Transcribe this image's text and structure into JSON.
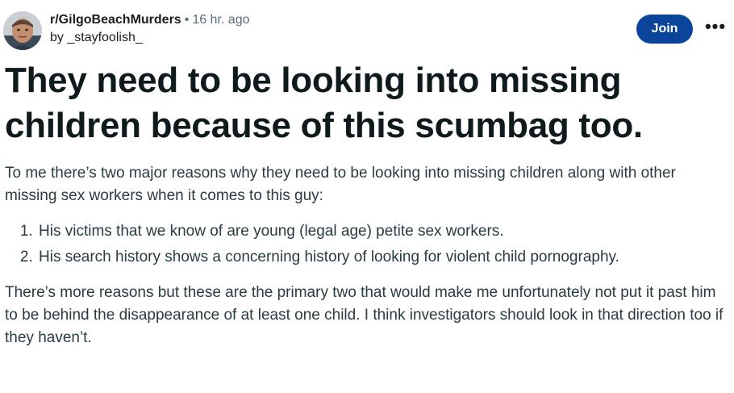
{
  "header": {
    "avatar_icon": "user-avatar-photo",
    "community": "r/GilgoBeachMurders",
    "separator": "•",
    "age": "16 hr. ago",
    "author": "by _stayfoolish_",
    "join_label": "Join",
    "more_label": "•••"
  },
  "post": {
    "title": "They need to be looking into missing children because of this scumbag too.",
    "intro": "To me there’s two major reasons why they need to be looking into missing children along with other missing sex workers when it comes to this guy:",
    "reasons": [
      "His victims that we know of are young (legal age) petite sex workers.",
      "His search history shows a concerning history of looking for violent child pornography."
    ],
    "conclusion": "There’s more reasons but these are the primary two that would make me unfortunately not put it past him to be behind the disappearance of at least one child. I think investigators should look in that direction too if they haven’t."
  },
  "colors": {
    "join_bg": "#0a449b",
    "text_muted": "#576f76",
    "body_text": "#2a3c42"
  }
}
